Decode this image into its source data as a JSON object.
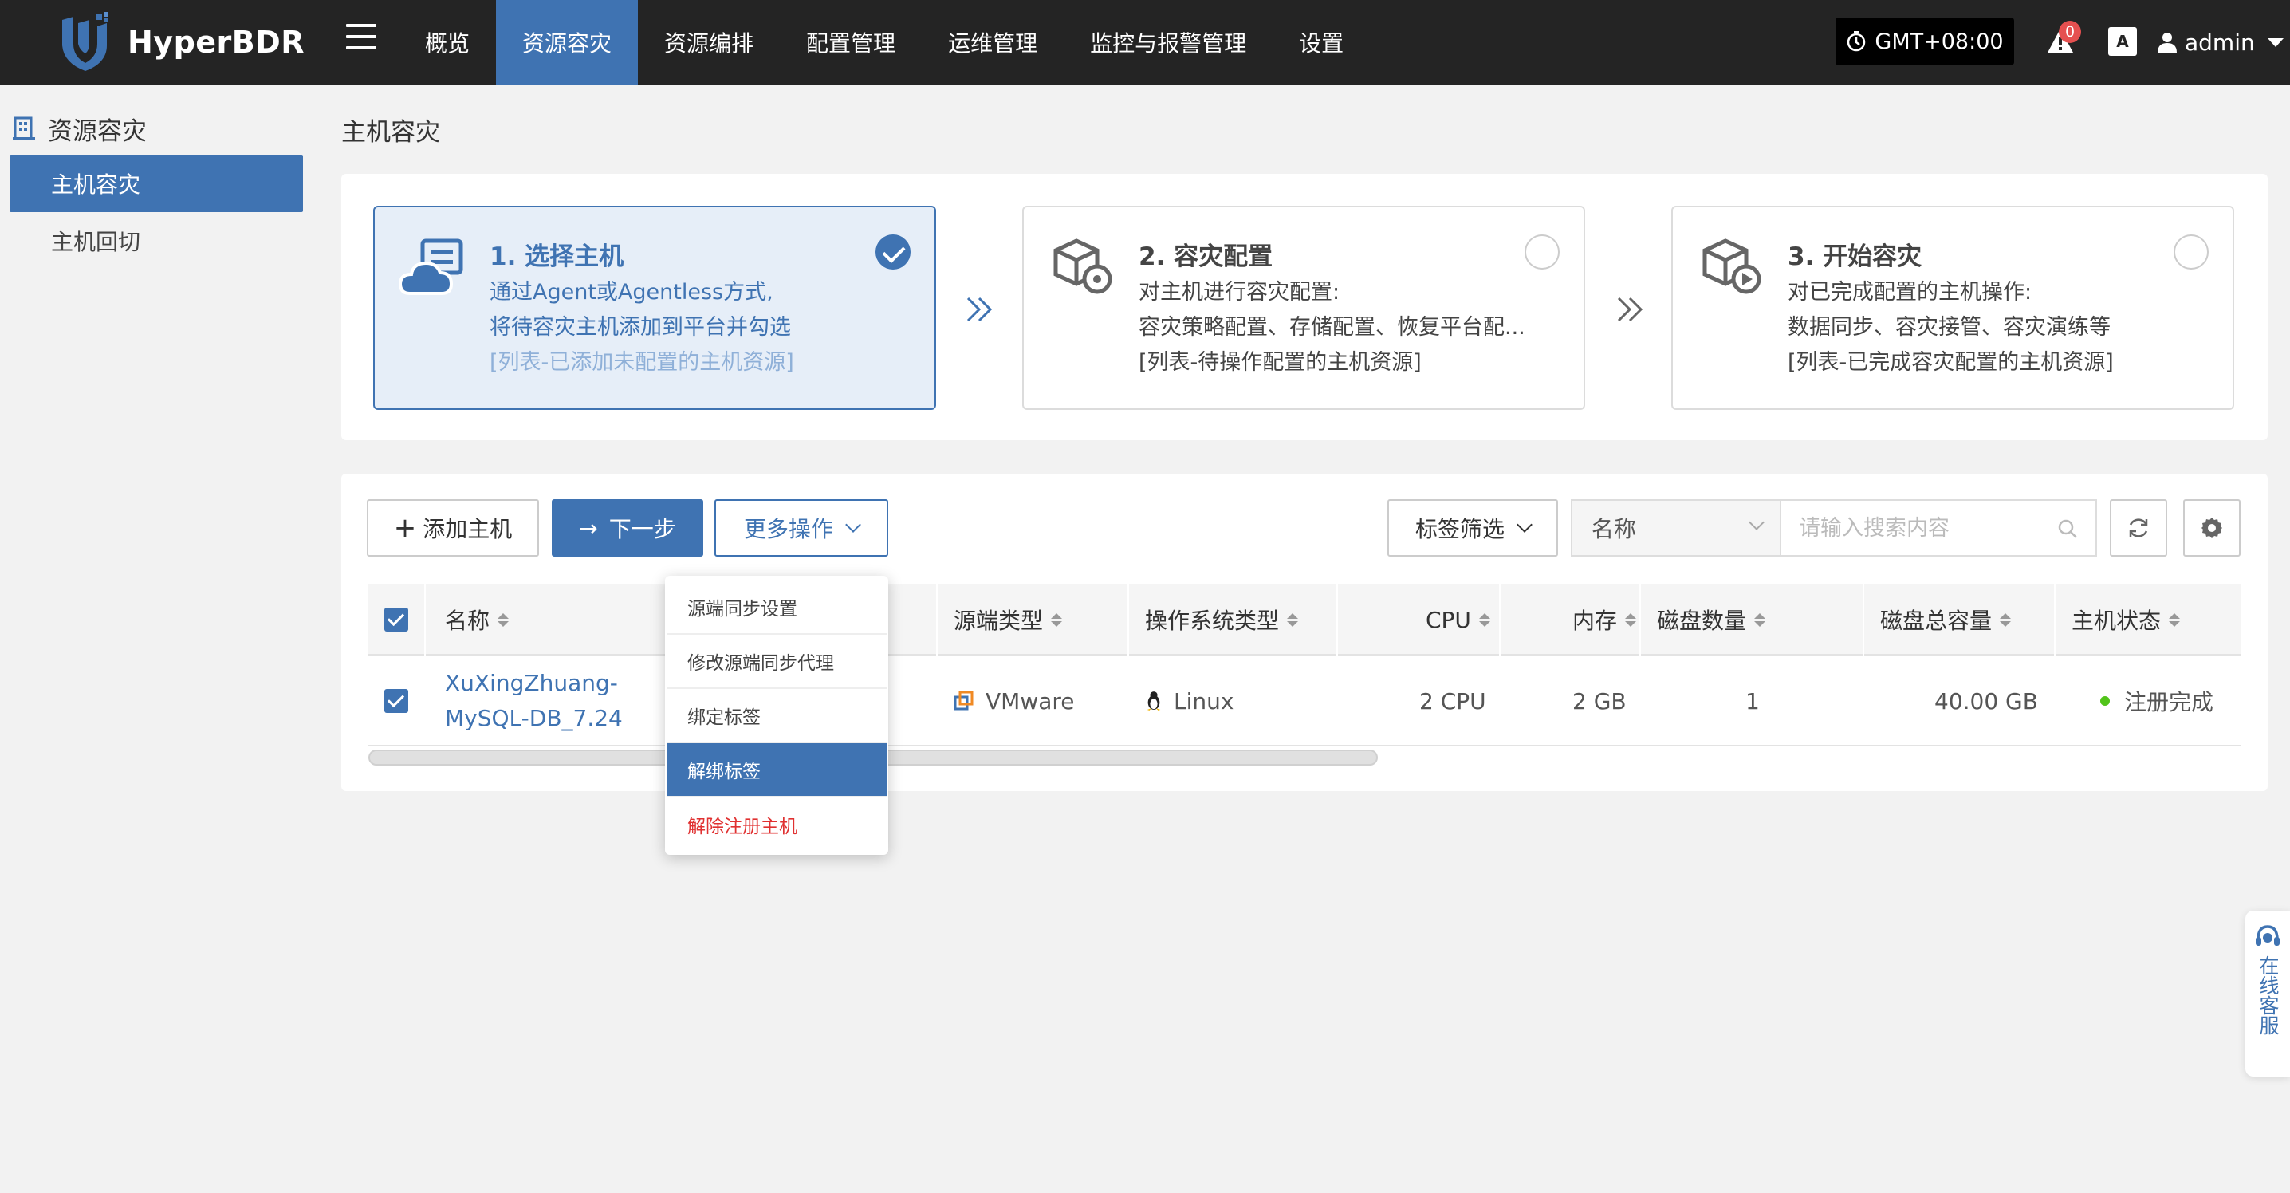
{
  "app": {
    "name": "HyperBDR"
  },
  "nav": {
    "items": [
      {
        "label": "概览",
        "active": false
      },
      {
        "label": "资源容灾",
        "active": true
      },
      {
        "label": "资源编排",
        "active": false
      },
      {
        "label": "配置管理",
        "active": false
      },
      {
        "label": "运维管理",
        "active": false
      },
      {
        "label": "监控与报警管理",
        "active": false
      },
      {
        "label": "设置",
        "active": false
      }
    ],
    "timezone": "GMT+08:00",
    "alert_count": "0",
    "translate_label": "A",
    "user": "admin"
  },
  "sidebar": {
    "title": "资源容灾",
    "items": [
      {
        "label": "主机容灾",
        "active": true
      },
      {
        "label": "主机回切",
        "active": false
      }
    ]
  },
  "page": {
    "title": "主机容灾"
  },
  "steps": [
    {
      "title": "1. 选择主机",
      "line1": "通过Agent或Agentless方式,",
      "line2": "将待容灾主机添加到平台并勾选",
      "line3": "[列表-已添加未配置的主机资源]",
      "checked": true
    },
    {
      "title": "2. 容灾配置",
      "line1": "对主机进行容灾配置:",
      "line2": "容灾策略配置、存储配置、恢复平台配...",
      "line3": "[列表-待操作配置的主机资源]",
      "checked": false
    },
    {
      "title": "3. 开始容灾",
      "line1": "对已完成配置的主机操作:",
      "line2": "数据同步、容灾接管、容灾演练等",
      "line3": "[列表-已完成容灾配置的主机资源]",
      "checked": false
    }
  ],
  "toolbar": {
    "add_host": "添加主机",
    "next_step": "下一步",
    "more_actions": "更多操作",
    "tag_filter": "标签筛选",
    "search_field": "名称",
    "search_placeholder": "请输入搜索内容"
  },
  "more_menu": {
    "items": [
      {
        "label": "源端同步设置"
      },
      {
        "label": "修改源端同步代理"
      },
      {
        "label": "绑定标签"
      },
      {
        "label": "解绑标签",
        "highlighted": true
      },
      {
        "label": "解除注册主机",
        "danger": true
      }
    ]
  },
  "table": {
    "columns": [
      "名称",
      "源端类型",
      "操作系统类型",
      "CPU",
      "内存",
      "磁盘数量",
      "磁盘总容量",
      "主机状态"
    ],
    "rows": [
      {
        "checked": true,
        "name": "XuXingZhuang-MySQL-DB_7.24",
        "source_type": "VMware",
        "os": "Linux",
        "cpu": "2 CPU",
        "memory": "2 GB",
        "disk_count": "1",
        "disk_total": "40.00 GB",
        "status": "注册完成",
        "status_color": "#52c41a"
      }
    ]
  },
  "service": {
    "label": "在线客服"
  },
  "colors": {
    "primary": "#3f73b2",
    "topbar": "#242424",
    "danger": "#e03131",
    "success": "#52c41a"
  }
}
